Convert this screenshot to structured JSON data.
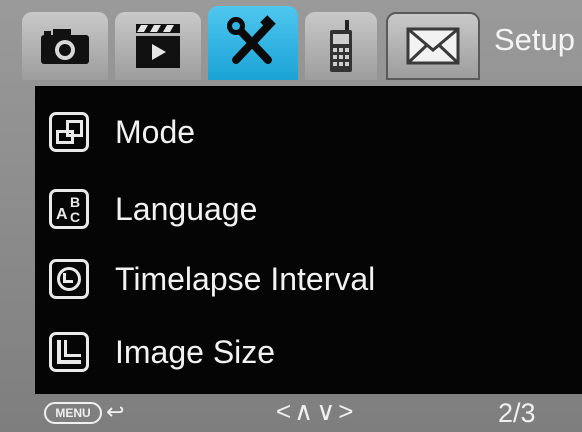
{
  "header": {
    "title": "Setup",
    "tabs": [
      {
        "icon": "camera-icon"
      },
      {
        "icon": "video-icon"
      },
      {
        "icon": "tools-icon",
        "active": true
      },
      {
        "icon": "cellular-icon"
      },
      {
        "icon": "envelope-icon"
      }
    ],
    "active_color": "#1aa3d6"
  },
  "menu": {
    "items": [
      {
        "label": "Mode",
        "icon": "mode-icon"
      },
      {
        "label": "Language",
        "icon": "language-icon"
      },
      {
        "label": "Timelapse Interval",
        "icon": "timelapse-interval-icon"
      },
      {
        "label": "Image Size",
        "icon": "image-size-icon"
      }
    ]
  },
  "language_icon": {
    "a": "A",
    "b": "B",
    "c": "C"
  },
  "footer": {
    "menu_key": "MENU",
    "back_glyph": "↩",
    "nav_hint": "<∧∨>",
    "page": "2/3"
  }
}
